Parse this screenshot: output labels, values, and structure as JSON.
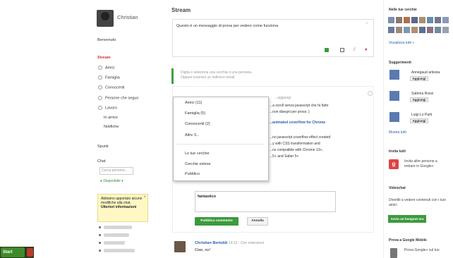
{
  "taskbar": {
    "start_label": "Start"
  },
  "profile": {
    "name": "Christian"
  },
  "left_nav": {
    "welcome": "Benvenuto",
    "stream": "Stream",
    "circles": [
      "Amici",
      "Famiglia",
      "Conoscenti",
      "Persone che seguo",
      "Lavoro"
    ],
    "incoming": "In arrivo",
    "notifications": "Notifiche",
    "sparks": "Spunti",
    "chat_title": "Chat",
    "chat_search_placeholder": "Cerca persone...",
    "status": "Disponibile"
  },
  "notice": {
    "text": "Abbiamo apportato alcune modifiche alla chat.",
    "link": "Ulteriori informazioni",
    "close": "×"
  },
  "main": {
    "title": "Stream",
    "share_text": "Questo è un messaggio di prova per vedere come funziona",
    "share_close": "×",
    "compose_hint": "Digita o seleziona una cerchia o una persona. Oppure inserisci un indirizzo email.",
    "post_lines": [
      "...a scroll senza javascript che fa fatto",
      "...non disegni per prova :)",
      "...animated coverflow for Chrome",
      "...no javascript coverflow effect created",
      "...y with CSS transformation and",
      "...ns compatible with Chrome 13+,",
      "...5+ and Safari 5+"
    ],
    "post_comment_header": "...aggiungi",
    "reply_text": "fantastico",
    "publish_label": "Pubblica commento",
    "cancel_label": "Annulla",
    "post2": {
      "author": "Christian Bertoldi",
      "meta": "· 14:12 · Con estensioni",
      "text": "Ciao, no!"
    }
  },
  "dropdown": {
    "items": [
      "Amici (11)",
      "Famiglia (5)",
      "Conoscenti (2)",
      "Altre 3..."
    ],
    "extra": [
      "Le tue cerchie",
      "Cerchie estese",
      "Pubblico"
    ]
  },
  "right_col": {
    "in_circles_title": "Nelle tue cerchie",
    "view_all": "Visualizza tutti »",
    "suggestions_title": "Suggerimenti",
    "suggestions": [
      {
        "name": "Annegaud artisoia",
        "button": "Aggiungi"
      },
      {
        "name": "Sabrina Rossi",
        "button": "Aggiungi"
      },
      {
        "name": "Luigi Lo Parti",
        "button": "Aggiungi"
      }
    ],
    "show_all": "Mostra tutti",
    "invite_title": "Invita tutti",
    "invite_text": "Invita altre persone a entrare in Google+",
    "mobile_title": "Videochat",
    "mobile_text": "Divertiti a vedere contenuti con i tuoi amici",
    "invite_button": "Avvia un hangout ora",
    "gmobile_title": "Prova a Google Mobile",
    "gmobile_text": "Prova Google+ sul tuo"
  },
  "colors": {
    "accent_green": "#3c9a3c",
    "link_blue": "#2a5db0",
    "stream_red": "#cc3333"
  }
}
